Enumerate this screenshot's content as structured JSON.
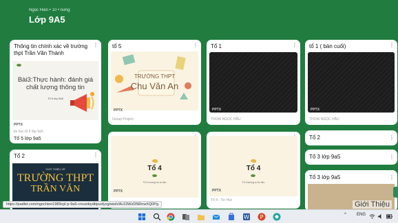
{
  "board": {
    "author": "Ngọc Hiền • 10 • nưng",
    "title": "Lớp 9A5"
  },
  "cards": {
    "c1": {
      "title": "Thông tin chính xác về trường thpt Trần Văn Thành",
      "slide_text": "Bài3:Thực hành: đánh giá chất lượng thông tin",
      "slide_small": "Tổ 5 lớp 9A5",
      "tag": "PPTX",
      "sub": "tin học tổ 5 lớp 9a5",
      "caption": "Tổ 5 lớp 9a5"
    },
    "c2": {
      "title": "tổ 5",
      "slide_line1": "TRƯỜNG THPT",
      "slide_line2": "Chu Văn An",
      "tag": "PPTX",
      "sub": "Group Project"
    },
    "c3": {
      "title": "Tổ 1",
      "tag": "PPTX",
      "sub": "THOẠI NGỌC HẦU"
    },
    "c4": {
      "title": "tổ 1 ( bản cuối)",
      "tag": "PPTX",
      "sub": "THOẠI NGỌC HẦU"
    },
    "c5": {
      "title": "Tổ 2"
    },
    "c6": {
      "title": "Tổ 3 lớp 9a5"
    },
    "c7": {
      "title": "Tổ 3 lớp 9a5",
      "slide_text": "Giới Thiệu"
    },
    "c8": {
      "title": "Tổ 2",
      "slide_line1": "TRƯỜNG THPT",
      "slide_line2": "TRẦN VĂN",
      "slide_small": "GIỚI THIỆU VỀ"
    },
    "c9": {
      "slide_big": "Tổ 4",
      "slide_small": "Tổ 4 trường tin tư liên",
      "tag": "PPTX"
    },
    "c10": {
      "slide_big": "Tổ 4",
      "slide_small": "Tổ 4 không tư tin liên",
      "tag": "PPTX",
      "sub": "Tổ 4 - Tin Học"
    }
  },
  "menu_icon": "⋮",
  "status_url": "https://padlet.com/ngochien1989cpl-p-9a5-cnvunbydbjozdyvg/wish/AL63WzDNRnwXQ0Pg",
  "taskbar": {
    "icons": [
      "windows-start",
      "search",
      "chrome",
      "task-view",
      "file-explorer",
      "mail",
      "store",
      "word",
      "powerpoint",
      "browser"
    ],
    "tray_lang": "ENG",
    "tray_arrow": "^"
  },
  "colors": {
    "board_bg": "#207d3f",
    "card_bg": "#ffffff",
    "taskbar_bg": "#e9ecf1"
  }
}
